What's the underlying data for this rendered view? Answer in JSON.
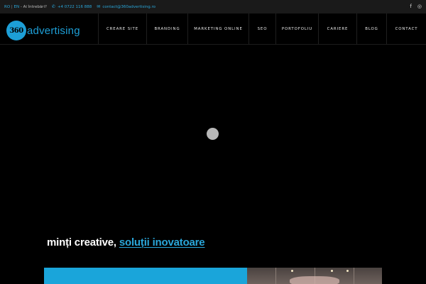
{
  "topbar": {
    "lang_ro": "RO",
    "lang_sep": " | ",
    "lang_en": "EN",
    "question": " - Ai întrebări?",
    "phone_icon": "phone-icon",
    "phone": "+4 0722 116 888",
    "email_icon": "mail-icon",
    "email": "contact@360advertising.ro",
    "social": [
      {
        "icon": "facebook-icon",
        "glyph": "f"
      },
      {
        "icon": "instagram-icon",
        "glyph": "◎"
      }
    ]
  },
  "logo": {
    "badge": "360",
    "word": "advertising"
  },
  "nav": {
    "items": [
      {
        "label": "CREARE SITE"
      },
      {
        "label": "BRANDING"
      },
      {
        "label": "MARKETING ONLINE"
      },
      {
        "label": "SEO"
      },
      {
        "label": "PORTOFOLIU"
      },
      {
        "label": "CARIERE"
      },
      {
        "label": "BLOG"
      },
      {
        "label": "CONTACT"
      }
    ]
  },
  "hero": {
    "tagline_main": "minți creative, ",
    "tagline_accent": "soluții inovatoare"
  },
  "colors": {
    "accent": "#1d9fd7",
    "background": "#000000",
    "topbar": "#1a1a1a"
  }
}
